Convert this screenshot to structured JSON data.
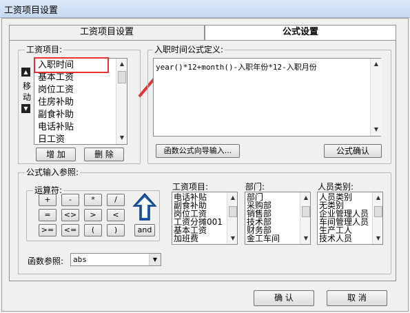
{
  "window": {
    "title": "工资项目设置"
  },
  "tabs": [
    {
      "label": "工资项目设置",
      "active": false
    },
    {
      "label": "公式设置",
      "active": true
    }
  ],
  "salary_items": {
    "label": "工资项目:",
    "items": [
      "入职时间",
      "基本工资",
      "岗位工资",
      "住房补助",
      "副食补助",
      "电话补贴",
      "日工资"
    ],
    "selected": "入职时间",
    "move_label": [
      "移",
      "动"
    ],
    "add_button": "增 加",
    "delete_button": "删 除"
  },
  "formula": {
    "label": "入职时间公式定义:",
    "text": "year()*12+month()-入职年份*12-入职月份",
    "wizard_button": "函数公式向导输入...",
    "confirm_button": "公式确认"
  },
  "formula_input": {
    "label": "公式输入参照:",
    "operators_label": "运算符:",
    "operators": [
      "+",
      "-",
      "*",
      "/",
      "=",
      "<>",
      ">",
      "<",
      ">=",
      "<=",
      "(",
      ")",
      "and"
    ],
    "function_ref_label": "函数参照:",
    "function_ref_value": "abs",
    "item_list": {
      "label": "工资项目:",
      "items": [
        "电话补贴",
        "副食补助",
        "岗位工资",
        "工资分摊001",
        "基本工资",
        "加班费"
      ]
    },
    "dept_list": {
      "label": "部门:",
      "items": [
        "部门",
        "采购部",
        "销售部",
        "技术部",
        "财务部",
        "金工车间"
      ]
    },
    "person_list": {
      "label": "人员类别:",
      "items": [
        "人员类别",
        "无类别",
        "企业管理人员",
        "车间管理人员",
        "生产工人",
        "技术人员"
      ]
    }
  },
  "footer": {
    "ok_button": "确 认",
    "cancel_button": "取 消"
  },
  "colors": {
    "highlight_red": "#e8312f",
    "arrow_blue": "#1a5fb4"
  }
}
